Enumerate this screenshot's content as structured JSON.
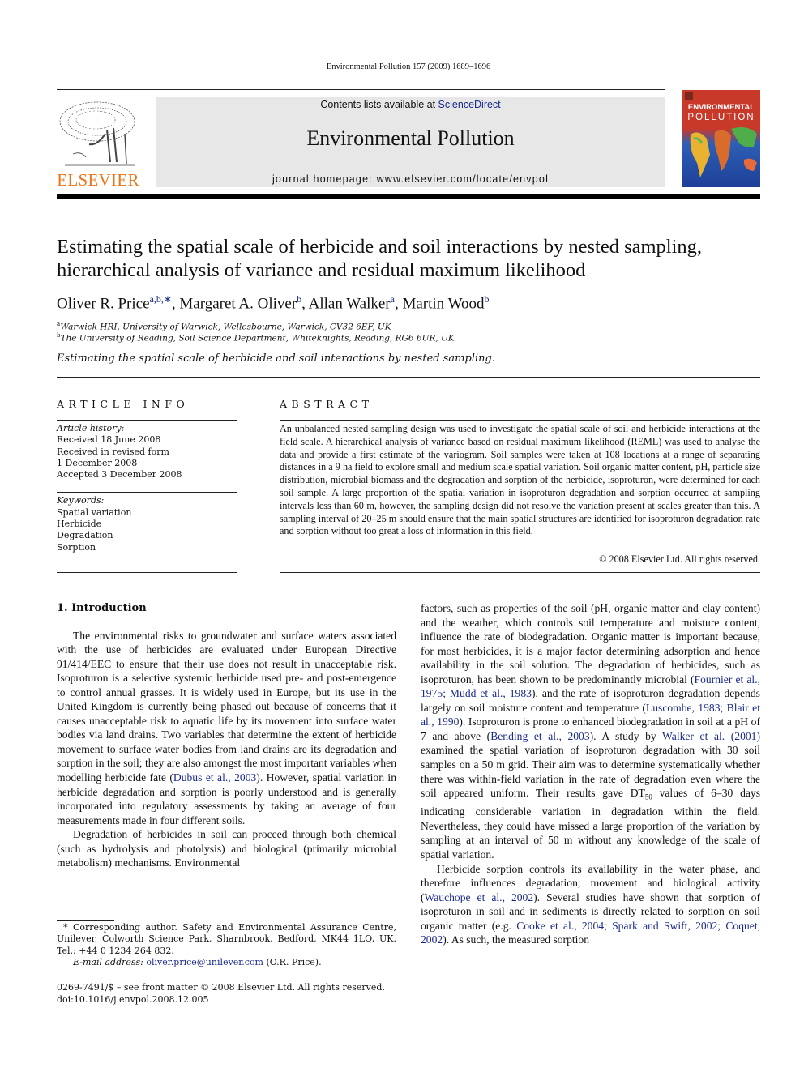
{
  "header": {
    "journal_ref": "Environmental Pollution 157 (2009) 1689–1696",
    "contents_prefix": "Contents lists available at ",
    "contents_link": "ScienceDirect",
    "journal_title": "Environmental Pollution",
    "homepage": "journal homepage: www.elsevier.com/locate/envpol",
    "publisher_logo_text": "ELSEVIER",
    "cover_line1": "ENVIRONMENTAL",
    "cover_line2": "POLLUTION",
    "colors": {
      "publisher_orange": "#e8761c",
      "link_blue": "#1a2a8c",
      "masthead_gray": "#e7e7e7"
    }
  },
  "article": {
    "title": "Estimating the spatial scale of herbicide and soil interactions by nested sampling, hierarchical analysis of variance and residual maximum likelihood",
    "authors": [
      {
        "name": "Oliver R. Price",
        "sup": "a,b,∗"
      },
      {
        "name": "Margaret A. Oliver",
        "sup": "b"
      },
      {
        "name": "Allan Walker",
        "sup": "a"
      },
      {
        "name": "Martin Wood",
        "sup": "b"
      }
    ],
    "affiliations": [
      {
        "mark": "a",
        "text": "Warwick-HRI, University of Warwick, Wellesbourne, Warwick, CV32 6EF, UK"
      },
      {
        "mark": "b",
        "text": "The University of Reading, Soil Science Department, Whiteknights, Reading, RG6 6UR, UK"
      }
    ],
    "short_title": "Estimating the spatial scale of herbicide and soil interactions by nested sampling."
  },
  "article_info": {
    "heading": "ARTICLE INFO",
    "history_label": "Article history:",
    "history": [
      "Received 18 June 2008",
      "Received in revised form",
      "1 December 2008",
      "Accepted 3 December 2008"
    ],
    "keywords_label": "Keywords:",
    "keywords": [
      "Spatial variation",
      "Herbicide",
      "Degradation",
      "Sorption"
    ]
  },
  "abstract": {
    "heading": "ABSTRACT",
    "text": "An unbalanced nested sampling design was used to investigate the spatial scale of soil and herbicide interactions at the field scale. A hierarchical analysis of variance based on residual maximum likelihood (REML) was used to analyse the data and provide a first estimate of the variogram. Soil samples were taken at 108 locations at a range of separating distances in a 9 ha field to explore small and medium scale spatial variation. Soil organic matter content, pH, particle size distribution, microbial biomass and the degradation and sorption of the herbicide, isoproturon, were determined for each soil sample. A large proportion of the spatial variation in isoproturon degradation and sorption occurred at sampling intervals less than 60 m, however, the sampling design did not resolve the variation present at scales greater than this. A sampling interval of 20–25 m should ensure that the main spatial structures are identified for isoproturon degradation rate and sorption without too great a loss of information in this field.",
    "copyright": "© 2008 Elsevier Ltd. All rights reserved."
  },
  "body": {
    "section_heading": "1.  Introduction",
    "left_p1": "The environmental risks to groundwater and surface waters associated with the use of herbicides are evaluated under European Directive 91/414/EEC to ensure that their use does not result in unacceptable risk. Isoproturon is a selective systemic herbicide used pre- and post-emergence to control annual grasses. It is widely used in Europe, but its use in the United Kingdom is currently being phased out because of concerns that it causes unacceptable risk to aquatic life by its movement into surface water bodies via land drains. Two variables that determine the extent of herbicide movement to surface water bodies from land drains are its degradation and sorption in the soil; they are also amongst the most important variables when modelling herbicide fate (",
    "left_p1_link": "Dubus et al., 2003",
    "left_p1_end": "). However, spatial variation in herbicide degradation and sorption is poorly understood and is generally incorporated into regulatory assessments by taking an average of four measurements made in four different soils.",
    "left_p2": "Degradation of herbicides in soil can proceed through both chemical (such as hydrolysis and photolysis) and biological (primarily microbial metabolism) mechanisms. Environmental",
    "right_p1_a": "factors, such as properties of the soil (pH, organic matter and clay content) and the weather, which controls soil temperature and moisture content, influence the rate of biodegradation. Organic matter is important because, for most herbicides, it is a major factor determining adsorption and hence availability in the soil solution. The degradation of herbicides, such as isoproturon, has been shown to be predominantly microbial (",
    "right_link1": "Fournier et al., 1975; Mudd et al., 1983",
    "right_p1_b": "), and the rate of isoproturon degradation depends largely on soil moisture content and temperature (",
    "right_link2": "Luscombe, 1983; Blair et al., 1990",
    "right_p1_c": "). Isoproturon is prone to enhanced biodegradation in soil at a pH of 7 and above (",
    "right_link3": "Bending et al., 2003",
    "right_p1_d": "). A study by ",
    "right_link4": "Walker et al. (2001)",
    "right_p1_e": " examined the spatial variation of isoproturon degradation with 30 soil samples on a 50 m grid. Their aim was to determine systematically whether there was within-field variation in the rate of degradation even where the soil appeared uniform. Their results gave DT",
    "right_sub": "50",
    "right_p1_f": " values of 6–30 days indicating considerable variation in degradation within the field. Nevertheless, they could have missed a large proportion of the variation by sampling at an interval of 50 m without any knowledge of the scale of spatial variation.",
    "right_p2_a": "Herbicide sorption controls its availability in the water phase, and therefore influences degradation, movement and biological activity (",
    "right_link5": "Wauchope et al., 2002",
    "right_p2_b": "). Several studies have shown that sorption of isoproturon in soil and in sediments is directly related to sorption on soil organic matter (e.g. ",
    "right_link6": "Cooke et al., 2004; Spark and Swift, 2002; Coquet, 2002",
    "right_p2_c": "). As such, the measured sorption"
  },
  "footnote": {
    "corresponding": "* Corresponding author. Safety and Environmental Assurance Centre, Unilever, Colworth Science Park, Sharnbrook, Bedford, MK44 1LQ, UK. Tel.: +44 0 1234 264 832.",
    "email_label": "E-mail address: ",
    "email": "oliver.price@unilever.com",
    "email_suffix": " (O.R. Price)."
  },
  "front_matter": {
    "issn_line": "0269-7491/$ – see front matter © 2008 Elsevier Ltd. All rights reserved.",
    "doi_line": "doi:10.1016/j.envpol.2008.12.005"
  }
}
